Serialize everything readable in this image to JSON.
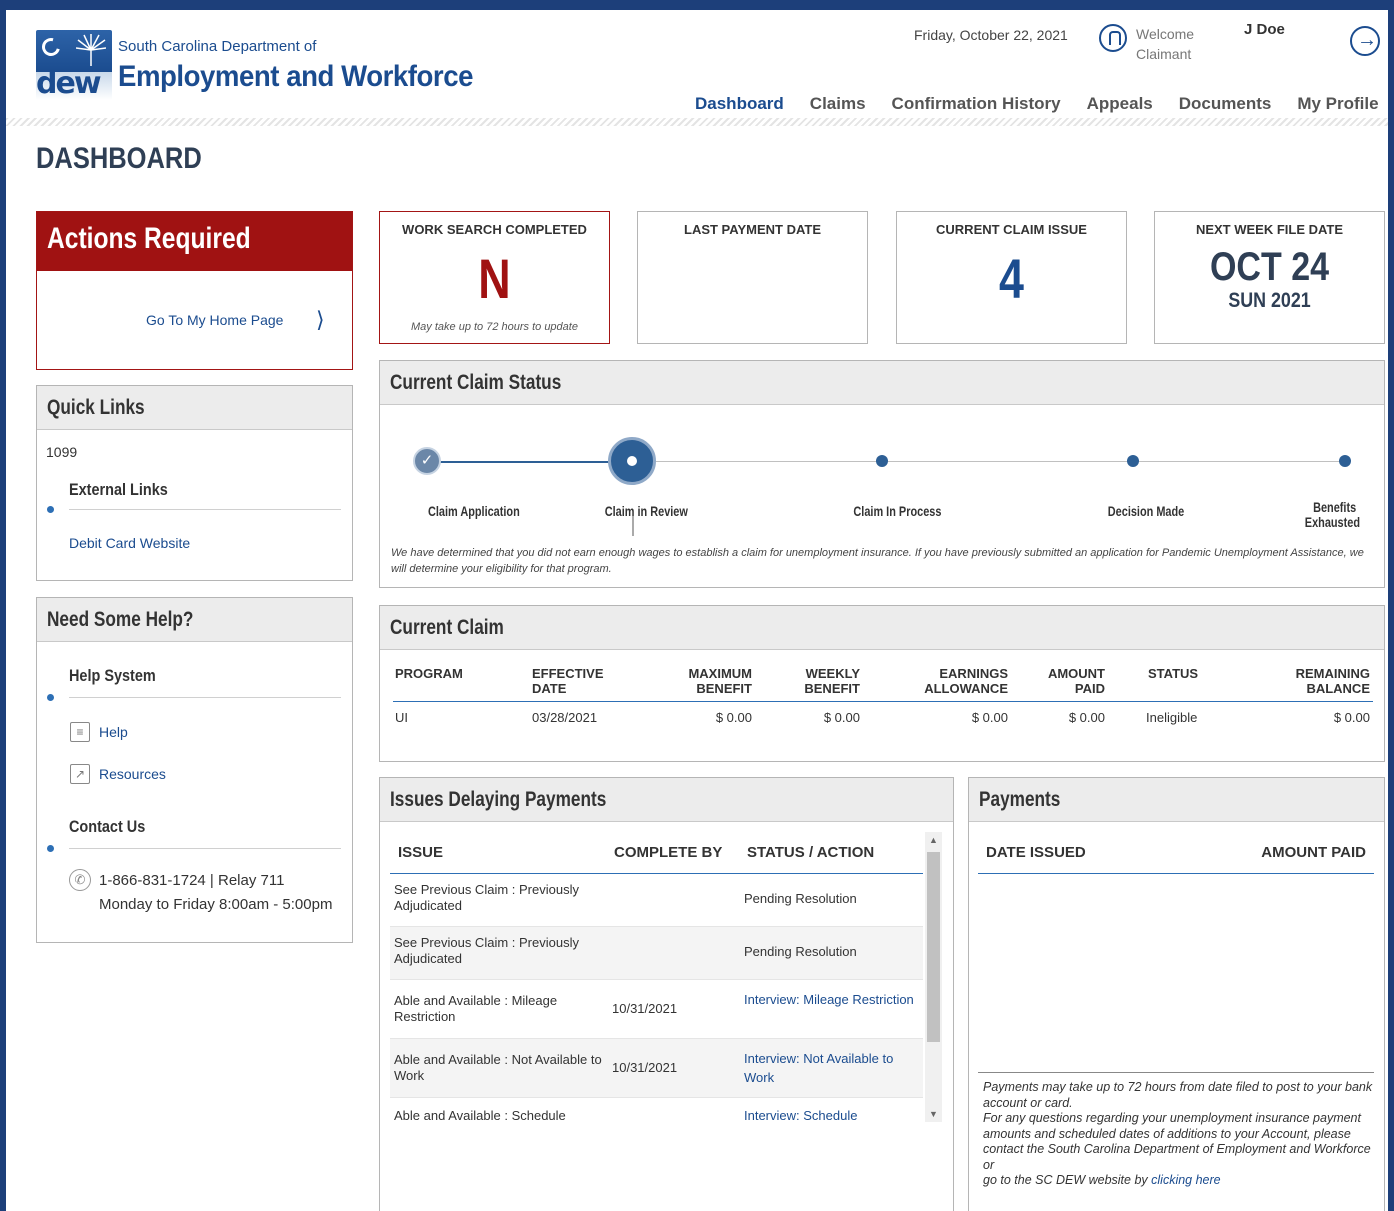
{
  "header": {
    "org_top": "South Carolina Department of",
    "org_main": "Employment and Workforce",
    "logo_text": "dew",
    "date": "Friday, October 22, 2021",
    "welcome_line1": "Welcome",
    "welcome_line2": "Claimant",
    "username": "J Doe",
    "nav": [
      "Dashboard",
      "Claims",
      "Confirmation History",
      "Appeals",
      "Documents",
      "My Profile"
    ],
    "active_nav": "Dashboard"
  },
  "page_title": "DASHBOARD",
  "actions_required": {
    "title": "Actions Required",
    "link": "Go To My Home Page"
  },
  "quick_links": {
    "title": "Quick Links",
    "item_1099": "1099",
    "external_heading": "External Links",
    "debit_card": "Debit Card Website"
  },
  "help": {
    "title": "Need Some Help?",
    "help_system_heading": "Help System",
    "help_link": "Help",
    "resources_link": "Resources",
    "contact_heading": "Contact Us",
    "phone": "1-866-831-1724 | Relay 711",
    "hours": "Monday to Friday 8:00am - 5:00pm"
  },
  "stats": {
    "work_search": {
      "label": "WORK SEARCH COMPLETED",
      "value": "N",
      "note": "May take up to 72 hours to update"
    },
    "last_payment": {
      "label": "LAST PAYMENT DATE",
      "value": ""
    },
    "claim_issue": {
      "label": "CURRENT CLAIM ISSUE",
      "value": "4"
    },
    "next_week": {
      "label": "NEXT WEEK FILE DATE",
      "date": "OCT 24",
      "day_year": "SUN 2021"
    }
  },
  "claim_status": {
    "title": "Current Claim Status",
    "steps": [
      "Claim Application",
      "Claim in Review",
      "Claim In Process",
      "Decision Made",
      "Benefits",
      "Exhausted"
    ],
    "current_step": "Claim in Review",
    "note": "We have determined that you did not earn enough wages to establish a claim for unemployment insurance. If you have previously submitted an application for Pandemic Unemployment Assistance, we will determine your eligibility for that program."
  },
  "current_claim": {
    "title": "Current Claim",
    "headers": {
      "program": "PROGRAM",
      "eff1": "EFFECTIVE",
      "eff2": "DATE",
      "max1": "MAXIMUM",
      "max2": "BENEFIT",
      "wk1": "WEEKLY",
      "wk2": "BENEFIT",
      "earn1": "EARNINGS",
      "earn2": "ALLOWANCE",
      "amt1": "AMOUNT",
      "amt2": "PAID",
      "status": "STATUS",
      "rem1": "REMAINING",
      "rem2": "BALANCE"
    },
    "row": {
      "program": "UI",
      "effective_date": "03/28/2021",
      "maximum_benefit": "$ 0.00",
      "weekly_benefit": "$ 0.00",
      "earnings_allowance": "$ 0.00",
      "amount_paid": "$ 0.00",
      "status": "Ineligible",
      "remaining_balance": "$ 0.00"
    }
  },
  "issues": {
    "title": "Issues Delaying Payments",
    "headers": {
      "issue": "ISSUE",
      "complete_by": "COMPLETE BY",
      "status": "STATUS / ACTION"
    },
    "rows": [
      {
        "issue": "See Previous Claim : Previously Adjudicated",
        "complete_by": "",
        "status": "Pending Resolution"
      },
      {
        "issue": "See Previous Claim : Previously Adjudicated",
        "complete_by": "",
        "status": "Pending Resolution"
      },
      {
        "issue": "Able and Available : Mileage Restriction",
        "complete_by": "10/31/2021",
        "status": "Interview: Mileage Restriction"
      },
      {
        "issue": "Able and Available : Not Available to Work",
        "complete_by": "10/31/2021",
        "status": "Interview: Not Available to Work"
      },
      {
        "issue": "Able and Available : Schedule",
        "complete_by": "",
        "status": "Interview: Schedule"
      }
    ]
  },
  "payments": {
    "title": "Payments",
    "headers": {
      "date_issued": "DATE ISSUED",
      "amount_paid": "AMOUNT PAID"
    },
    "note1": "Payments may take up to 72 hours from date filed to post to your bank account or card.",
    "note2": "For any questions regarding your unemployment insurance payment amounts and scheduled dates of additions to your Account, please contact the South Carolina Department of Employment and Workforce or",
    "note3": "go to the SC DEW website by",
    "note_link": "clicking here"
  },
  "colors": {
    "brand_blue": "#1b4c8f",
    "alert_red": "#a01212",
    "frame": "#1d3f7a"
  }
}
